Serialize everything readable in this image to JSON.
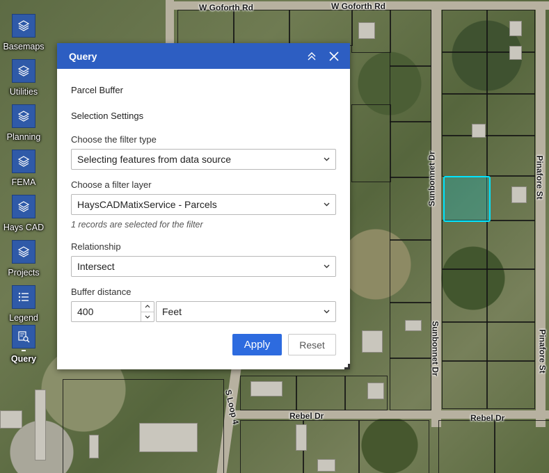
{
  "map": {
    "roads": [
      {
        "id": "goforth-1",
        "label": "W Goforth Rd"
      },
      {
        "id": "goforth-2",
        "label": "W Goforth Rd"
      },
      {
        "id": "sunbonnet-1",
        "label": "Sunbonnet Dr"
      },
      {
        "id": "sunbonnet-2",
        "label": "Sunbonnet Dr"
      },
      {
        "id": "pinafore-1",
        "label": "Pinafore St"
      },
      {
        "id": "pinafore-2",
        "label": "Pinafore St"
      },
      {
        "id": "sloop",
        "label": "S Loop 4"
      },
      {
        "id": "rebel-1",
        "label": "Rebel Dr"
      },
      {
        "id": "rebel-2",
        "label": "Rebel Dr"
      }
    ],
    "selection_color": "#00e5ff"
  },
  "toolbar": {
    "items": [
      {
        "label": "Basemaps",
        "icon": "layers-icon"
      },
      {
        "label": "Utilities",
        "icon": "layers-icon"
      },
      {
        "label": "Planning",
        "icon": "layers-icon"
      },
      {
        "label": "FEMA",
        "icon": "layers-icon"
      },
      {
        "label": "Hays CAD",
        "icon": "layers-icon"
      },
      {
        "label": "Projects",
        "icon": "layers-icon"
      },
      {
        "label": "Legend",
        "icon": "list-icon"
      },
      {
        "label": "Query",
        "icon": "query-icon",
        "active": true
      }
    ],
    "accent": "#2f5aa8"
  },
  "panel": {
    "title": "Query",
    "header_color": "#2d5ec2",
    "query_name": "Parcel Buffer",
    "section": "Selection Settings",
    "filter_type_label": "Choose the filter type",
    "filter_type_value": "Selecting features from data source",
    "filter_layer_label": "Choose a filter layer",
    "filter_layer_value": "HaysCADMatixService - Parcels",
    "records_hint": "1 records are selected for the filter",
    "relationship_label": "Relationship",
    "relationship_value": "Intersect",
    "buffer_label": "Buffer distance",
    "buffer_value": "400",
    "buffer_unit": "Feet",
    "apply_label": "Apply",
    "reset_label": "Reset",
    "apply_color": "#2d6bdf"
  }
}
